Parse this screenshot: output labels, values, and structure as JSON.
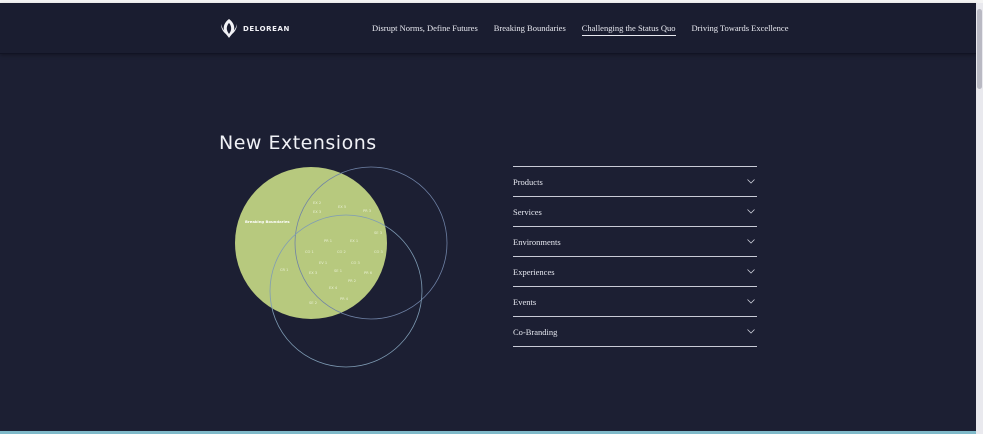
{
  "header": {
    "logo_text": "DELOREAN",
    "nav": [
      {
        "label": "Disrupt Norms, Define Futures",
        "active": false
      },
      {
        "label": "Breaking Boundaries",
        "active": false
      },
      {
        "label": "Challenging the Status Quo",
        "active": true
      },
      {
        "label": "Driving Towards Excellence",
        "active": false
      }
    ]
  },
  "main": {
    "title": "New Extensions",
    "venn": {
      "highlight_color": "#b7c97e",
      "outline_color": "#6f82a6",
      "highlight_label": "Breaking Boundaries",
      "labels": [
        "EX 2",
        "EX 3",
        "EX 5",
        "PR 3",
        "SE 3",
        "PR 1",
        "EX 1",
        "CO 1",
        "CO 2",
        "CO 3",
        "EV 1",
        "CO 3",
        "EX 3",
        "SE 1",
        "PR 6",
        "CR 1",
        "EX 4",
        "PR 2",
        "SE 2",
        "PR 4"
      ]
    },
    "accordion": [
      {
        "label": "Products"
      },
      {
        "label": "Services"
      },
      {
        "label": "Environments"
      },
      {
        "label": "Experiences"
      },
      {
        "label": "Events"
      },
      {
        "label": "Co-Branding"
      }
    ]
  }
}
